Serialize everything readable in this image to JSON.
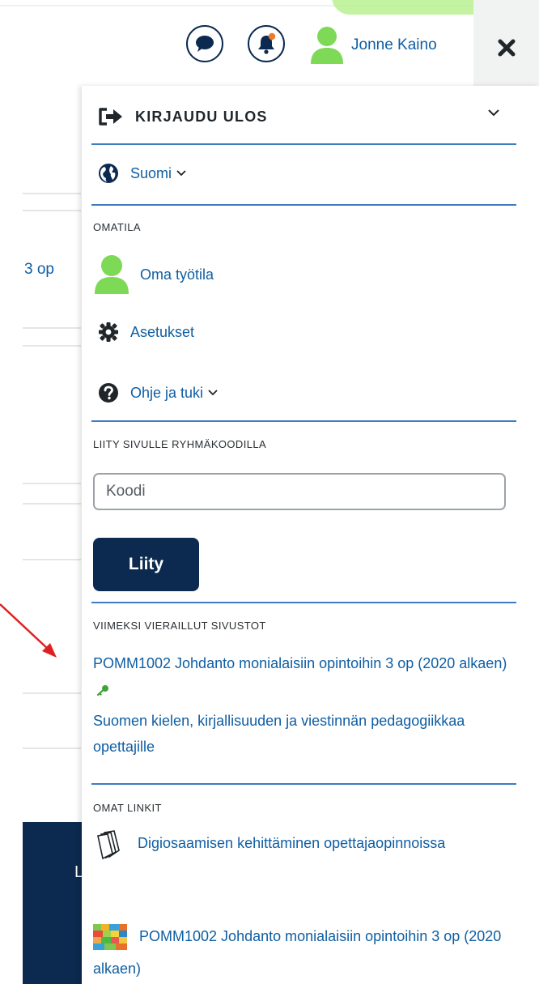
{
  "header": {
    "user_name": "Jonne Kaino",
    "icons": [
      "chat-icon",
      "bell-icon",
      "user-avatar-icon",
      "close-icon"
    ]
  },
  "background": {
    "partial_text": "3 op",
    "partial_letter": "L"
  },
  "drawer": {
    "logout_label": "KIRJAUDU ULOS",
    "language_label": "Suomi",
    "omatila": {
      "heading": "OMATILA",
      "workspace_label": "Oma työtila",
      "settings_label": "Asetukset",
      "help_label": "Ohje ja tuki"
    },
    "join": {
      "heading": "LIITY SIVULLE RYHMÄKOODILLA",
      "input_placeholder": "Koodi",
      "button_label": "Liity"
    },
    "recent": {
      "heading": "VIIMEKSI VIERAILLUT SIVUSTOT",
      "items": [
        "POMM1002 Johdanto monialaisiin opintoihin 3 op (2020 alkaen)",
        "Suomen kielen, kirjallisuuden ja viestinnän pedagogiikkaa opettajille"
      ]
    },
    "my_links": {
      "heading": "OMAT LINKIT",
      "items": [
        "Digiosaamisen kehittäminen opettajaopinnoissa",
        "POMM1002 Johdanto monialaisiin opintoihin 3 op (2020 alkaen)"
      ]
    }
  },
  "colors": {
    "navy": "#0c2a4f",
    "link_blue": "#0f5ea3",
    "divider_blue": "#3e7cc0",
    "avatar_green": "#7ed957",
    "annotation_red": "#e02020"
  }
}
